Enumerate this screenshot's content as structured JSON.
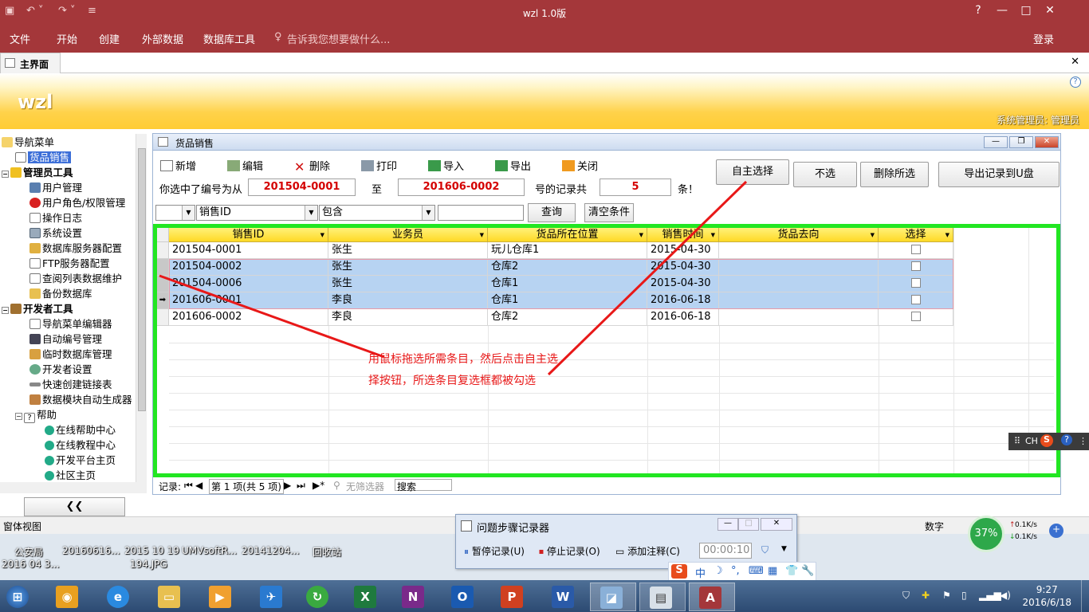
{
  "window": {
    "title": "wzl 1.0版",
    "controls": [
      "?",
      "—",
      "□",
      "✕"
    ],
    "login_label": "登录"
  },
  "menu": {
    "items": [
      "文件",
      "开始",
      "创建",
      "外部数据",
      "数据库工具"
    ],
    "tell_me": "告诉我您想要做什么..."
  },
  "tab": {
    "label": "主界面"
  },
  "banner": {
    "logo": "wzl",
    "user": "系统管理员: 管理员"
  },
  "nav": {
    "items": [
      {
        "label": "导航菜单"
      },
      {
        "label": "货品销售"
      },
      {
        "label": "管理员工具"
      },
      {
        "label": "用户管理"
      },
      {
        "label": "用户角色/权限管理"
      },
      {
        "label": "操作日志"
      },
      {
        "label": "系统设置"
      },
      {
        "label": "数据库服务器配置"
      },
      {
        "label": "FTP服务器配置"
      },
      {
        "label": "查阅列表数据维护"
      },
      {
        "label": "备份数据库"
      },
      {
        "label": "开发者工具"
      },
      {
        "label": "导航菜单编辑器"
      },
      {
        "label": "自动编号管理"
      },
      {
        "label": "临时数据库管理"
      },
      {
        "label": "开发者设置"
      },
      {
        "label": "快速创建链接表"
      },
      {
        "label": "数据模块自动生成器"
      },
      {
        "label": "帮助"
      },
      {
        "label": "在线帮助中心"
      },
      {
        "label": "在线教程中心"
      },
      {
        "label": "开发平台主页"
      },
      {
        "label": "社区主页"
      }
    ],
    "collapse_label": "❮❮"
  },
  "form": {
    "title": "货品销售",
    "toolbar": {
      "new": "新增",
      "edit": "编辑",
      "delete": "删除",
      "print": "打印",
      "import": "导入",
      "export": "导出",
      "close": "关闭"
    },
    "buttons": {
      "self_select": "自主选择",
      "deselect": "不选",
      "delete_selected": "删除所选",
      "export_usb": "导出记录到U盘"
    },
    "selection": {
      "prefix": "你选中了编号为从",
      "from": "201504-0001",
      "to_label": "至",
      "to": "201606-0002",
      "count_label": "号的记录共",
      "count": "5",
      "suffix": "条！"
    },
    "filter": {
      "field0": "",
      "field": "销售ID",
      "op": "包含",
      "value": "",
      "query": "查询",
      "clear": "清空条件"
    },
    "grid": {
      "columns": [
        "销售ID",
        "业务员",
        "货品所在位置",
        "销售时间",
        "货品去向",
        "选择"
      ],
      "rows": [
        {
          "id": "201504-0001",
          "agent": "张生",
          "loc": "玩儿仓库1",
          "date": "2015-04-30",
          "dest": "",
          "checked": false
        },
        {
          "id": "201504-0002",
          "agent": "张生",
          "loc": "仓库2",
          "date": "2015-04-30",
          "dest": "",
          "checked": false
        },
        {
          "id": "201504-0006",
          "agent": "张生",
          "loc": "仓库1",
          "date": "2015-04-30",
          "dest": "",
          "checked": false
        },
        {
          "id": "201606-0001",
          "agent": "李良",
          "loc": "仓库1",
          "date": "2016-06-18",
          "dest": "",
          "checked": false
        },
        {
          "id": "201606-0002",
          "agent": "李良",
          "loc": "仓库2",
          "date": "2016-06-18",
          "dest": "",
          "checked": false
        }
      ]
    },
    "record_nav": {
      "label": "记录:",
      "position": "第 1 项(共 5 项)",
      "no_filter": "无筛选器",
      "search": "搜索"
    }
  },
  "annotation": "用鼠标拖选所需条目，然后点击自主选择按钮，所选条目复选框都被勾选",
  "status": {
    "left": "窗体视图",
    "right": "数字"
  },
  "desktop": {
    "items": [
      "公安局",
      "20160616...",
      "2015 10 19",
      "UMVsoftR...",
      "20141204...",
      "回收站"
    ],
    "sub": [
      "2016 04 3...",
      "194.JPG"
    ]
  },
  "psr": {
    "title": "问题步骤记录器",
    "pause": "暂停记录(U)",
    "stop": "停止记录(O)",
    "comment": "添加注释(C)",
    "timer": "00:00:10"
  },
  "ime": {
    "lang": "CH",
    "mode": "中"
  },
  "network": {
    "percent": "37%",
    "up": "0.1K/s",
    "down": "0.1K/s"
  },
  "clock": {
    "time": "9:27",
    "date": "2016/6/18"
  },
  "colors": {
    "accent": "#a4373a",
    "banner": "#ffcc33",
    "highlight": "#22e622",
    "annotation": "#e81818"
  }
}
